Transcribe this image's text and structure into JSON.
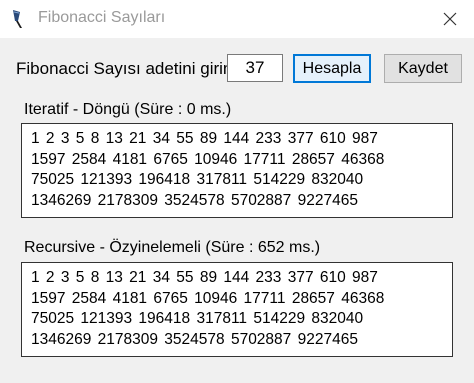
{
  "window": {
    "title": "Fibonacci Sayıları",
    "icon": "feather-pen-icon",
    "close_icon": "close-icon"
  },
  "controls": {
    "count_label": "Fibonacci Sayısı adetini girin:",
    "count_value": "37",
    "calculate_label": "Hesapla",
    "save_label": "Kaydet"
  },
  "iterative": {
    "label": "Iteratif - Döngü (Süre : 0 ms.)",
    "result": "1 2 3 5 8 13 21 34 55 89 144 233 377 610 987\n1597 2584 4181 6765 10946 17711 28657 46368\n75025 121393 196418 317811 514229 832040\n1346269 2178309 3524578 5702887 9227465"
  },
  "recursive": {
    "label": "Recursive - Özyinelemeli (Süre : 652 ms.)",
    "result": "1 2 3 5 8 13 21 34 55 89 144 233 377 610 987\n1597 2584 4181 6765 10946 17711 28657 46368\n75025 121393 196418 317811 514229 832040\n1346269 2178309 3524578 5702887 9227465"
  }
}
